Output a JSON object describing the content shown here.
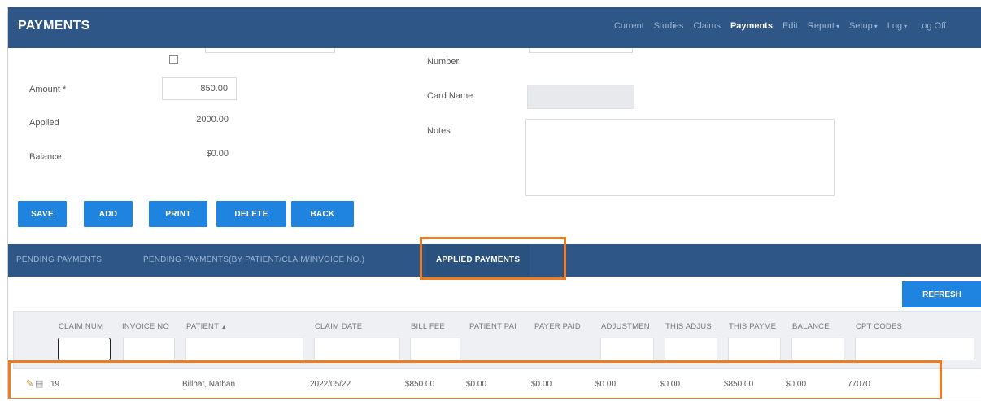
{
  "app": {
    "title": "PAYMENTS"
  },
  "nav": {
    "items": [
      {
        "label": "Current",
        "active": false
      },
      {
        "label": "Studies",
        "active": false
      },
      {
        "label": "Claims",
        "active": false
      },
      {
        "label": "Payments",
        "active": true
      },
      {
        "label": "Edit",
        "active": false
      },
      {
        "label": "Report",
        "active": false,
        "dropdown": true
      },
      {
        "label": "Setup",
        "active": false,
        "dropdown": true
      },
      {
        "label": "Log",
        "active": false,
        "dropdown": true
      },
      {
        "label": "Log Off",
        "active": false
      }
    ]
  },
  "form": {
    "amount_label": "Amount *",
    "amount_value": "850.00",
    "applied_label": "Applied",
    "applied_value": "2000.00",
    "balance_label": "Balance",
    "balance_value": "$0.00",
    "number_label": "Number",
    "card_name_label": "Card Name",
    "notes_label": "Notes"
  },
  "buttons": {
    "save": "SAVE",
    "add": "ADD",
    "print": "PRINT",
    "delete": "DELETE",
    "back": "BACK",
    "refresh": "REFRESH"
  },
  "tabs": {
    "pending": "PENDING PAYMENTS",
    "pending_filtered": "PENDING PAYMENTS(BY PATIENT/CLAIM/INVOICE NO.)",
    "applied": "APPLIED PAYMENTS"
  },
  "grid": {
    "columns": [
      "CLAIM NUM",
      "INVOICE NO",
      "PATIENT",
      "CLAIM DATE",
      "BILL FEE",
      "PATIENT PAI",
      "PAYER PAID",
      "ADJUSTMEN",
      "THIS ADJUS",
      "THIS PAYME",
      "BALANCE",
      "CPT CODES"
    ],
    "sort_indicator": "▲",
    "rows": [
      {
        "claim_num": "19",
        "invoice_no": "",
        "patient": "Billhat, Nathan",
        "claim_date": "2022/05/22",
        "bill_fee": "$850.00",
        "patient_paid": "$0.00",
        "payer_paid": "$0.00",
        "adjustment": "$0.00",
        "this_adjust": "$0.00",
        "this_payment": "$850.00",
        "balance": "$0.00",
        "cpt_codes": "77070"
      }
    ]
  },
  "colors": {
    "navbar": "#2e5686",
    "button": "#1f84e0",
    "highlight": "#f07c22"
  }
}
